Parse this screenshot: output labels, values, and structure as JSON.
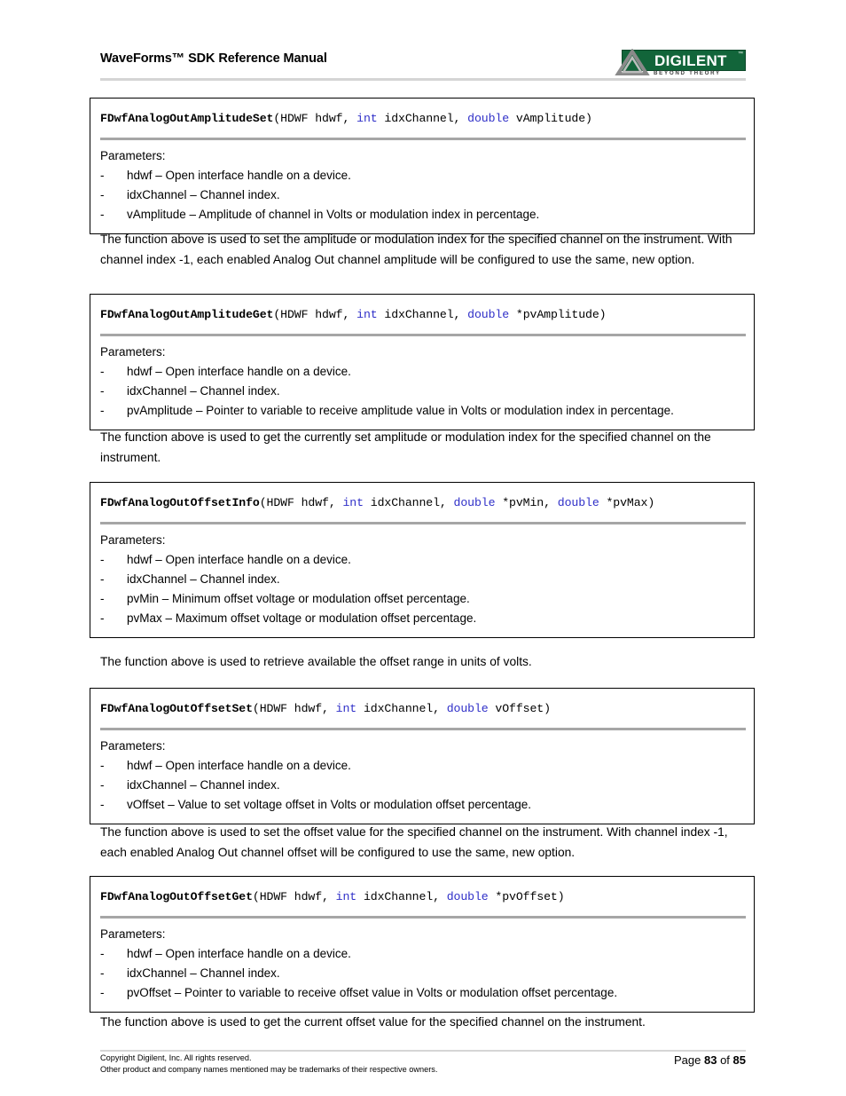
{
  "header": {
    "title": "WaveForms™ SDK Reference Manual",
    "logo": {
      "word": "DIGILENT",
      "trademark": "™",
      "tagline": "BEYOND THEORY",
      "plate_color": "#12653a",
      "text_color": "#ffffff"
    }
  },
  "colors": {
    "keyword_blue": "#2f2fc8",
    "separator_gray": "#a6a6a6",
    "rule_gray": "#d5d5d5"
  },
  "labels": {
    "parameters": "Parameters:",
    "bullet": "-"
  },
  "functions": [
    {
      "name": "FDwfAnalogOutAmplitudeSet",
      "signature_tokens": [
        {
          "text": "FDwfAnalogOutAmplitudeSet",
          "style": "fname"
        },
        {
          "text": "(HDWF hdwf, ",
          "style": "plain"
        },
        {
          "text": "int",
          "style": "kw"
        },
        {
          "text": " idxChannel, ",
          "style": "plain"
        },
        {
          "text": "double",
          "style": "kw"
        },
        {
          "text": " vAmplitude)",
          "style": "plain"
        }
      ],
      "parameters": [
        "hdwf – Open interface handle on a device.",
        "idxChannel – Channel index.",
        "vAmplitude – Amplitude of channel in Volts or modulation index in percentage."
      ]
    },
    {
      "name": "FDwfAnalogOutAmplitudeGet",
      "signature_tokens": [
        {
          "text": "FDwfAnalogOutAmplitudeGet",
          "style": "fname"
        },
        {
          "text": "(HDWF hdwf, ",
          "style": "plain"
        },
        {
          "text": "int",
          "style": "kw"
        },
        {
          "text": " idxChannel, ",
          "style": "plain"
        },
        {
          "text": "double",
          "style": "kw"
        },
        {
          "text": " *pvAmplitude)",
          "style": "plain"
        }
      ],
      "parameters": [
        "hdwf – Open interface handle on a device.",
        "idxChannel – Channel index.",
        "pvAmplitude – Pointer to variable to receive amplitude value in Volts or modulation index in percentage."
      ]
    },
    {
      "name": "FDwfAnalogOutOffsetInfo",
      "signature_tokens": [
        {
          "text": "FDwfAnalogOutOffsetInfo",
          "style": "fname"
        },
        {
          "text": "(HDWF hdwf, ",
          "style": "plain"
        },
        {
          "text": "int",
          "style": "kw"
        },
        {
          "text": " idxChannel, ",
          "style": "plain"
        },
        {
          "text": "double",
          "style": "kw"
        },
        {
          "text": " *pvMin, ",
          "style": "plain"
        },
        {
          "text": "double",
          "style": "kw"
        },
        {
          "text": " *pvMax)",
          "style": "plain"
        }
      ],
      "parameters": [
        "hdwf – Open interface handle on a device.",
        "idxChannel – Channel index.",
        "pvMin – Minimum offset voltage or modulation offset percentage.",
        "pvMax – Maximum offset voltage or modulation offset percentage."
      ]
    },
    {
      "name": "FDwfAnalogOutOffsetSet",
      "signature_tokens": [
        {
          "text": "FDwfAnalogOutOffsetSet",
          "style": "fname"
        },
        {
          "text": "(HDWF hdwf, ",
          "style": "plain"
        },
        {
          "text": "int",
          "style": "kw"
        },
        {
          "text": " idxChannel, ",
          "style": "plain"
        },
        {
          "text": "double",
          "style": "kw"
        },
        {
          "text": " vOffset)",
          "style": "plain"
        }
      ],
      "parameters": [
        "hdwf – Open interface handle on a device.",
        "idxChannel – Channel index.",
        "vOffset – Value to set voltage offset in Volts or modulation offset percentage."
      ]
    },
    {
      "name": "FDwfAnalogOutOffsetGet",
      "signature_tokens": [
        {
          "text": "FDwfAnalogOutOffsetGet",
          "style": "fname"
        },
        {
          "text": "(HDWF hdwf, ",
          "style": "plain"
        },
        {
          "text": "int",
          "style": "kw"
        },
        {
          "text": " idxChannel, ",
          "style": "plain"
        },
        {
          "text": "double",
          "style": "kw"
        },
        {
          "text": " *pvOffset)",
          "style": "plain"
        }
      ],
      "parameters": [
        "hdwf – Open interface handle on a device.",
        "idxChannel – Channel index.",
        "pvOffset – Pointer to variable to receive offset value in Volts or modulation offset percentage."
      ]
    }
  ],
  "paragraphs": [
    "The function above is used to set the amplitude or modulation index for the specified channel on the instrument. With channel index -1, each enabled Analog Out channel amplitude will be configured to use the same, new option.",
    "The function above is used to get the currently set amplitude or modulation index for the specified channel on the instrument.",
    "The function above is used to retrieve available the offset range in units of volts.",
    "The function above is used to set the offset value for the specified channel on the instrument. With channel index -1, each enabled Analog Out channel offset will be configured to use the same, new option.",
    "The function above is used to get the current offset value for the specified channel on the instrument."
  ],
  "footer": {
    "copyright_line1": "Copyright Digilent, Inc. All rights reserved.",
    "copyright_line2": "Other product and company names mentioned may be trademarks of their respective owners.",
    "page_prefix": "Page",
    "page_number": "83",
    "page_middle": "of",
    "page_total": "85"
  }
}
